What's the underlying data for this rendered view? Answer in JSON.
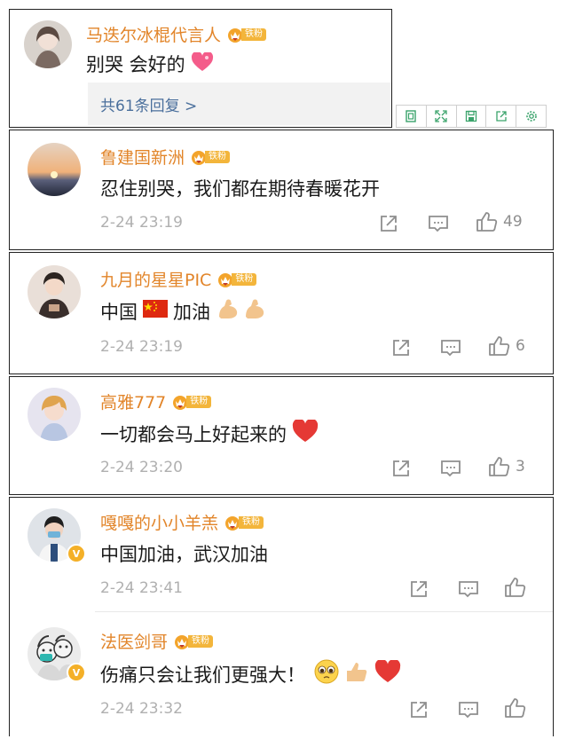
{
  "top_comment": {
    "name": "马迭尔冰棍代言人",
    "badge": "铁粉",
    "text": "别哭 会好的",
    "replies_label": "共61条回复 >"
  },
  "comments": [
    {
      "name": "鲁建国新洲",
      "badge": "铁粉",
      "text": "忍住别哭，我们都在期待春暖花开",
      "time": "2-24 23:19",
      "likes": "49"
    },
    {
      "name": "九月的星星PIC",
      "badge": "铁粉",
      "text_a": "中国",
      "text_b": "加油",
      "time": "2-24 23:19",
      "likes": "6"
    },
    {
      "name": "高雅777",
      "badge": "铁粉",
      "text": "一切都会马上好起来的",
      "time": "2-24 23:20",
      "likes": "3"
    },
    {
      "name": "嘎嘎的小小羊羔",
      "badge": "铁粉",
      "text": "中国加油，武汉加油",
      "time": "2-24 23:41",
      "likes": ""
    },
    {
      "name": "法医剑哥",
      "badge": "铁粉",
      "text": "伤痛只会让我们更强大！",
      "time": "2-24 23:32",
      "likes": ""
    }
  ],
  "icons": {
    "share": "share-icon",
    "comment": "comment-icon",
    "like": "thumbs-up-icon"
  },
  "colors": {
    "name": "#e2852a",
    "badge": "#f3b53b",
    "reply_link": "#4a6f9c",
    "time": "#b0b0b0"
  }
}
